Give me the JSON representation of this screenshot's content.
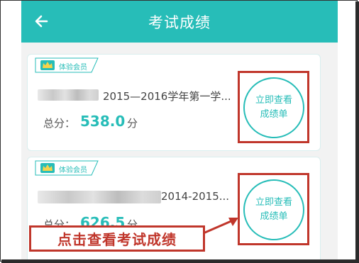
{
  "header": {
    "title": "考试成绩"
  },
  "records": [
    {
      "member_badge": "体验会员",
      "exam_name": "2015—2016学年第一学...",
      "score_label": "总分：",
      "score_value": "538.0",
      "score_unit": "分",
      "button_line1": "立即查看",
      "button_line2": "成绩单"
    },
    {
      "member_badge": "体验会员",
      "exam_name": "2014-2015...",
      "score_label": "总分：",
      "score_value": "626.5",
      "score_unit": "分",
      "button_line1": "立即查看",
      "button_line2": "成绩单"
    }
  ],
  "annotation": {
    "text": "点击查看考试成绩",
    "color": "#c0362b"
  },
  "colors": {
    "brand": "#27bdb8",
    "highlight": "#c0362b"
  },
  "icons": {
    "back": "back-arrow-icon",
    "crown": "crown-icon"
  }
}
